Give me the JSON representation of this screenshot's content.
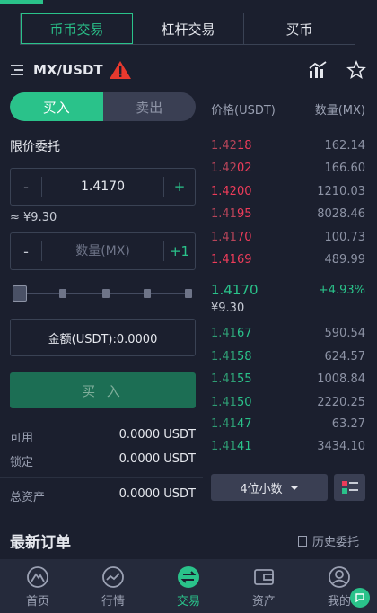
{
  "colors": {
    "accent": "#2ac28a",
    "ask": "#ee3c5a",
    "bg": "#1b1f2e"
  },
  "top_tabs": [
    "币币交易",
    "杠杆交易",
    "买币"
  ],
  "pair": {
    "name": "MX/USDT"
  },
  "side": {
    "buy": "买入",
    "sell": "卖出"
  },
  "order_type": "限价委托",
  "price_input": {
    "minus": "-",
    "value": "1.4170",
    "plus": "+"
  },
  "approx_cny": "≈ ¥9.30",
  "qty_input": {
    "minus": "-",
    "placeholder": "数量(MX)",
    "plus": "+1"
  },
  "slider_level": 0,
  "amount": "金额(USDT):0.0000",
  "buy_button": "买 入",
  "balances": [
    {
      "label": "可用",
      "value": "0.0000 USDT"
    },
    {
      "label": "锁定",
      "value": "0.0000 USDT"
    },
    {
      "label": "总资产",
      "value": "0.0000 USDT"
    }
  ],
  "orderbook": {
    "header_price": "价格(USDT)",
    "header_qty": "数量(MX)",
    "asks": [
      {
        "base": "1.42",
        "hl": "18",
        "qty": "162.14"
      },
      {
        "base": "1.42",
        "hl": "02",
        "qty": "166.60"
      },
      {
        "base": "",
        "hl": "1.4200",
        "qty": "1210.03"
      },
      {
        "base": "1.41",
        "hl": "95",
        "qty": "8028.46"
      },
      {
        "base": "1.41",
        "hl": "70",
        "qty": "100.73"
      },
      {
        "base": "",
        "hl": "1.4169",
        "qty": "489.99"
      }
    ],
    "last": {
      "price": "1.4170",
      "change": "+4.93%",
      "cny": "¥9.30"
    },
    "bids": [
      {
        "base": "1.41",
        "hl": "67",
        "qty": "590.54"
      },
      {
        "base": "1.41",
        "hl": "58",
        "qty": "624.57"
      },
      {
        "base": "1.41",
        "hl": "55",
        "qty": "1008.84"
      },
      {
        "base": "1.41",
        "hl": "50",
        "qty": "2220.25"
      },
      {
        "base": "1.41",
        "hl": "47",
        "qty": "63.27"
      },
      {
        "base": "1.41",
        "hl": "41",
        "qty": "3434.10"
      }
    ],
    "decimals": "4位小数"
  },
  "latest_orders": {
    "title": "最新订单",
    "history": "历史委托"
  },
  "nav": [
    {
      "label": "首页",
      "icon": "home-icon"
    },
    {
      "label": "行情",
      "icon": "market-icon"
    },
    {
      "label": "交易",
      "icon": "trade-icon"
    },
    {
      "label": "资产",
      "icon": "wallet-icon"
    },
    {
      "label": "我的",
      "icon": "user-icon"
    }
  ]
}
